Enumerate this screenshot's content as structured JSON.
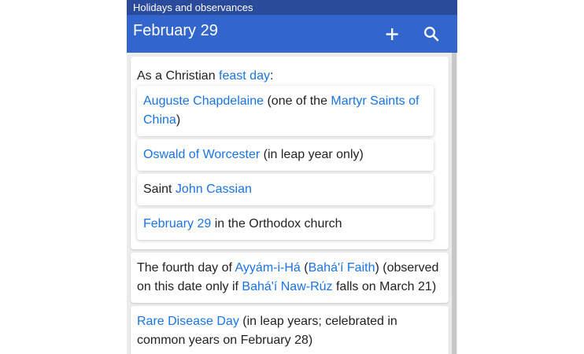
{
  "status_bar": {
    "title": "Holidays and observances"
  },
  "app_bar": {
    "title": "February 29",
    "add_icon": "plus-icon",
    "search_icon": "search-icon"
  },
  "colors": {
    "status_bar": "#2a4a9c",
    "app_bar": "#3366cc",
    "link": "#1a73e8",
    "background": "#ececec"
  },
  "cards": {
    "christian": {
      "prefix": "As a Christian ",
      "link": "feast day",
      "suffix": ":",
      "items": [
        {
          "link1": "Auguste Chapdelaine",
          "text1": " (one of the ",
          "link2": "Martyr Saints of China",
          "text2": ")"
        },
        {
          "link": "Oswald of Worcester",
          "text": " (in leap year only)"
        },
        {
          "prefix": "Saint ",
          "link": "John Cassian"
        },
        {
          "link": "February 29",
          "text": " in the Orthodox church"
        }
      ]
    },
    "bahai": {
      "t1": "The fourth day of ",
      "l1": "Ayyám-i-Há",
      "t2": " (",
      "l2": "Bahá'í Faith",
      "t3": ") (observed on this date only if ",
      "l3": "Bahá'í Naw-Rúz",
      "t4": " falls on March 21)"
    },
    "rare": {
      "link": "Rare Disease Day",
      "text": " (in leap years; celebrated in common years on February 28)"
    }
  }
}
